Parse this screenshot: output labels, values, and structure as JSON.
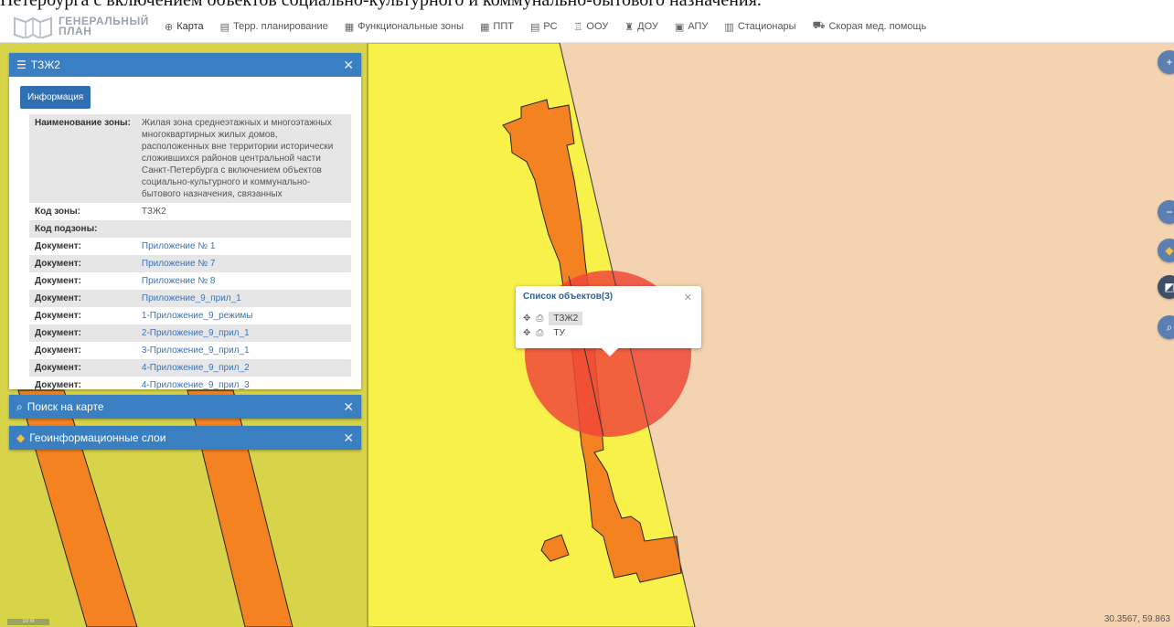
{
  "caption": "Петербурга с включением объектов социально-культурного и коммунально-бытового назначения.",
  "logo": {
    "line1": "ГЕНЕРАЛЬНЫЙ",
    "line2": "ПЛАН"
  },
  "nav": [
    {
      "label": "Карта",
      "icon": "globe-icon",
      "glyph": "⊕"
    },
    {
      "label": "Терр. планирование",
      "icon": "document-icon",
      "glyph": "▤"
    },
    {
      "label": "Функциональные зоны",
      "icon": "grid-icon",
      "glyph": "▦"
    },
    {
      "label": "ППТ",
      "icon": "table-icon",
      "glyph": "▦"
    },
    {
      "label": "РС",
      "icon": "list-icon",
      "glyph": "▤"
    },
    {
      "label": "ООУ",
      "icon": "school-icon",
      "glyph": "♖"
    },
    {
      "label": "ДОУ",
      "icon": "kindergarten-icon",
      "glyph": "♜"
    },
    {
      "label": "АПУ",
      "icon": "clinic-icon",
      "glyph": "▣"
    },
    {
      "label": "Стационары",
      "icon": "hospital-icon",
      "glyph": "▥"
    },
    {
      "label": "Скорая мед. помощь",
      "icon": "ambulance-icon",
      "glyph": "⛟"
    }
  ],
  "info_panel": {
    "title": "ТЗЖ2",
    "button": "Информация",
    "rows": [
      {
        "key": "Наименование зоны:",
        "value": "Жилая зона среднеэтажных и многоэтажных многоквартирных жилых домов, расположенных вне территории исторически сложившихся районов центральной части Санкт-Петербурга с включением объектов социально-культурного и коммунально-бытового назначения, связанных",
        "link": false
      },
      {
        "key": "Код зоны:",
        "value": "ТЗЖ2",
        "link": false
      },
      {
        "key": "Код подзоны:",
        "value": "",
        "link": false
      },
      {
        "key": "Документ:",
        "value": "Приложение № 1",
        "link": true
      },
      {
        "key": "Документ:",
        "value": "Приложение № 7",
        "link": true
      },
      {
        "key": "Документ:",
        "value": "Приложение № 8",
        "link": true
      },
      {
        "key": "Документ:",
        "value": "Приложение_9_прил_1",
        "link": true
      },
      {
        "key": "Документ:",
        "value": "1-Приложение_9_режимы",
        "link": true
      },
      {
        "key": "Документ:",
        "value": "2-Приложение_9_прил_1",
        "link": true
      },
      {
        "key": "Документ:",
        "value": "3-Приложение_9_прил_1",
        "link": true
      },
      {
        "key": "Документ:",
        "value": "4-Приложение_9_прил_2",
        "link": true
      },
      {
        "key": "Документ:",
        "value": "4-Приложение_9_прил_3",
        "link": true
      }
    ]
  },
  "search_panel": {
    "title": "Поиск на карте"
  },
  "layers_panel": {
    "title": "Геоинформационные слои"
  },
  "popup": {
    "title": "Список объектов(3)",
    "items": [
      {
        "label": "ТЗЖ2",
        "selected": true
      },
      {
        "label": "ТУ",
        "selected": false
      }
    ]
  },
  "coords": "30.3567, 59.863",
  "scale_label": "10 m",
  "colors": {
    "header_blue": "#3a7fc1",
    "zone_yellow": "#f7f14a",
    "zone_olive": "#d8d44a",
    "building_orange": "#f58220",
    "highlight_red": "#f0483a",
    "peach": "#f4d3b0"
  }
}
